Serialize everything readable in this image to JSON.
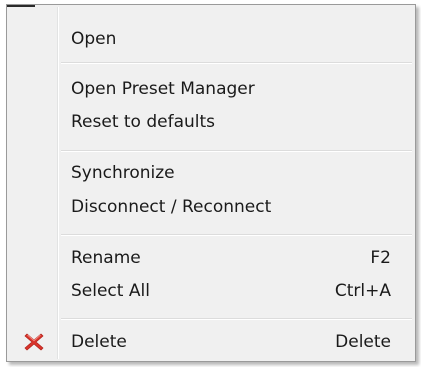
{
  "menu": {
    "items": [
      {
        "label": "Open",
        "shortcut": "",
        "icon": ""
      },
      {
        "label": "Open Preset Manager",
        "shortcut": "",
        "icon": ""
      },
      {
        "label": "Reset to defaults",
        "shortcut": "",
        "icon": ""
      },
      {
        "label": "Synchronize",
        "shortcut": "",
        "icon": ""
      },
      {
        "label": "Disconnect / Reconnect",
        "shortcut": "",
        "icon": ""
      },
      {
        "label": "Rename",
        "shortcut": "F2",
        "icon": ""
      },
      {
        "label": "Select All",
        "shortcut": "Ctrl+A",
        "icon": ""
      },
      {
        "label": "Delete",
        "shortcut": "Delete",
        "icon": "red-x-icon"
      }
    ]
  },
  "colors": {
    "menu_background": "#f0f0f0",
    "delete_icon": "#d9342b"
  }
}
